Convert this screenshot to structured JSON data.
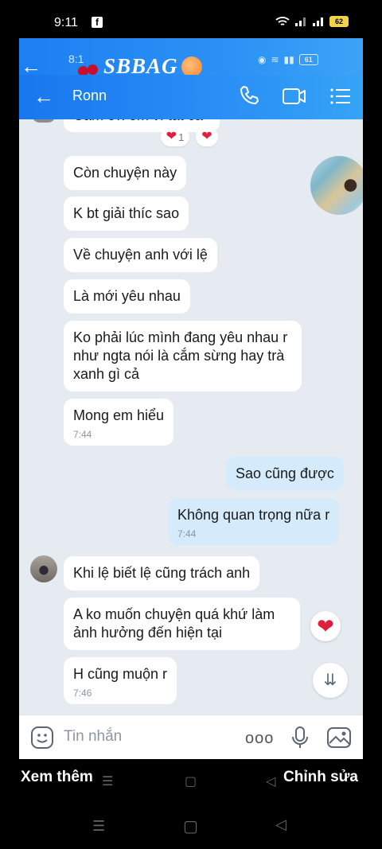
{
  "outer_status": {
    "time": "9:11",
    "battery": "62"
  },
  "inner_status": {
    "time": "8:1",
    "brand": "SBBAG",
    "battery": "61"
  },
  "header": {
    "contact_name": "Ronn"
  },
  "messages": {
    "top_cut": "Cảm ơn em vì tất cả",
    "react_count": "1",
    "m1": "Còn chuyện này",
    "m2": "K bt giải thíc sao",
    "m3": "Về chuyện anh với lệ",
    "m4": "Là mới yêu nhau",
    "m5": "Ko phải lúc mình đang yêu nhau r như ngta nói là cắm sừng hay trà xanh  gì cả",
    "m6": "Mong em hiểu",
    "m6_time": "7:44",
    "mine1": "Sao cũng được",
    "mine2": "Không quan trọng nữa r",
    "mine2_time": "7:44",
    "m7": "Khi lệ biết lệ cũng trách anh",
    "m8": "A ko muốn chuyện quá khứ làm ảnh hưởng đến hiện tại",
    "m9": "H cũng muộn r",
    "m9_time": "7:46"
  },
  "input": {
    "placeholder": "Tin nhắn",
    "more": "ooo"
  },
  "bottom": {
    "more_label": "Xem thêm",
    "edit_label": "Chỉnh sửa"
  },
  "colors": {
    "header_blue": "#2a8ff6",
    "chat_bg": "#e6ebf1",
    "mine_bubble": "#d5ebfc",
    "heart": "#e01f3d"
  },
  "icons": [
    "back-arrow-icon",
    "phone-icon",
    "video-icon",
    "menu-icon",
    "emoji-icon",
    "mic-icon",
    "image-icon",
    "chevron-double-down-icon",
    "heart-icon"
  ]
}
